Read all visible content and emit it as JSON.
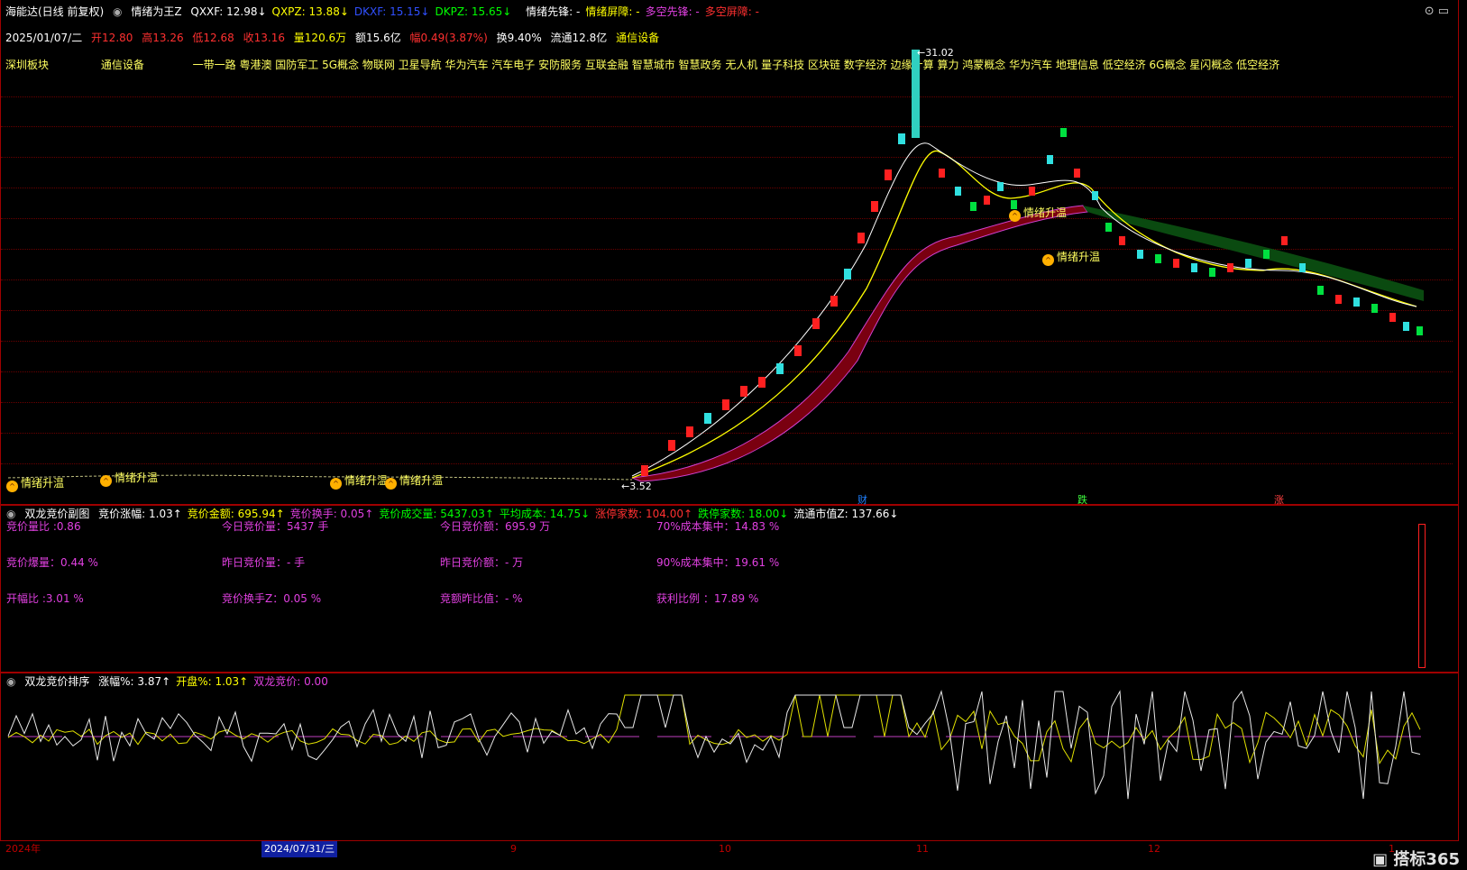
{
  "header": {
    "title": "海能达(日线 前复权)",
    "indicator": "情绪为王Z",
    "items": [
      {
        "label": "QXXF:",
        "value": "12.98",
        "arrow": "↓",
        "color": "#ffffff"
      },
      {
        "label": "QXPZ:",
        "value": "13.88",
        "arrow": "↓",
        "color": "#ffff00"
      },
      {
        "label": "DKXF:",
        "value": "15.15",
        "arrow": "↓",
        "color": "#3050ff"
      },
      {
        "label": "DKPZ:",
        "value": "15.65",
        "arrow": "↓",
        "color": "#00ff00"
      }
    ],
    "signals": [
      {
        "label": "情绪先锋:",
        "value": "-",
        "color": "#ffffff"
      },
      {
        "label": "情绪屏障:",
        "value": "-",
        "color": "#ffff00"
      },
      {
        "label": "多空先锋:",
        "value": "-",
        "color": "#e040e0"
      },
      {
        "label": "多空屏障:",
        "value": "-",
        "color": "#ff3030"
      }
    ]
  },
  "quote": {
    "date": "2025/01/07/二",
    "open": "开12.80",
    "high": "高13.26",
    "low": "低12.68",
    "close": "收13.16",
    "volume": "量120.6万",
    "amount": "额15.6亿",
    "change": "幅0.49(3.87%)",
    "turnover": "换9.40%",
    "float_cap": "流通12.8亿",
    "industry": "通信设备"
  },
  "concepts": {
    "board": "深圳板块",
    "industry": "通信设备",
    "list": "一带一路 粤港澳 国防军工 5G概念 物联网 卫星导航 华为汽车 汽车电子 安防服务 互联金融 智慧城市 智慧政务 无人机 量子科技 区块链 数字经济 边缘计算 算力 鸿蒙概念 华为汽车 地理信息 低空经济 6G概念 星闪概念 低空经济"
  },
  "price_chart": {
    "max_label": "31.02",
    "min_label": "3.52",
    "events": [
      "财",
      "跌",
      "涨"
    ],
    "tags": [
      "情绪升温",
      "情绪升温",
      "情绪升温",
      "情绪升温",
      "情绪升温",
      "情绪升温"
    ]
  },
  "panel2": {
    "title": "双龙竞价副图",
    "items": [
      {
        "label": "竞价涨幅:",
        "value": "1.03",
        "arrow": "↑",
        "color": "#ffffff"
      },
      {
        "label": "竞价金额:",
        "value": "695.94",
        "arrow": "↑",
        "color": "#ffff00"
      },
      {
        "label": "竞价换手:",
        "value": "0.05",
        "arrow": "↑",
        "color": "#e040e0"
      },
      {
        "label": "竞价成交量:",
        "value": "5437.03",
        "arrow": "↑",
        "color": "#00ff00"
      },
      {
        "label": "平均成本:",
        "value": "14.75",
        "arrow": "↓",
        "color": "#00ff00"
      },
      {
        "label": "涨停家数:",
        "value": "104.00",
        "arrow": "↑",
        "color": "#ff3030"
      },
      {
        "label": "跌停家数:",
        "value": "18.00",
        "arrow": "↓",
        "color": "#00ff00"
      },
      {
        "label": "流通市值Z:",
        "value": "137.66",
        "arrow": "↓",
        "color": "#ffffff"
      }
    ],
    "stats": [
      {
        "label": "竞价量比 :0.86"
      },
      {
        "label": "今日竞价量：5437  手"
      },
      {
        "label": "今日竞价额：695.9  万"
      },
      {
        "label": "70%成本集中：14.83  %"
      },
      {
        "label": "竞价爆量：0.44  %"
      },
      {
        "label": "昨日竞价量：-  手"
      },
      {
        "label": "昨日竞价额：-  万"
      },
      {
        "label": "90%成本集中：19.61  %"
      },
      {
        "label": "开幅比   :3.01  %"
      },
      {
        "label": "竞价换手Z：0.05  %"
      },
      {
        "label": "竞额昨比值：-  %"
      },
      {
        "label": "获利比例     ：17.89  %"
      }
    ]
  },
  "panel3": {
    "title": "双龙竞价排序",
    "items": [
      {
        "label": "涨幅%:",
        "value": "3.87",
        "arrow": "↑",
        "color": "#ffffff"
      },
      {
        "label": "开盘%:",
        "value": "1.03",
        "arrow": "↑",
        "color": "#ffff00"
      },
      {
        "label": "双龙竞价:",
        "value": "0.00",
        "arrow": "",
        "color": "#e040e0"
      }
    ]
  },
  "x_axis": {
    "labels": [
      "2024年",
      "2024/07/31/三",
      "9",
      "10",
      "11",
      "12",
      "1"
    ]
  },
  "logo": "搭标365"
}
